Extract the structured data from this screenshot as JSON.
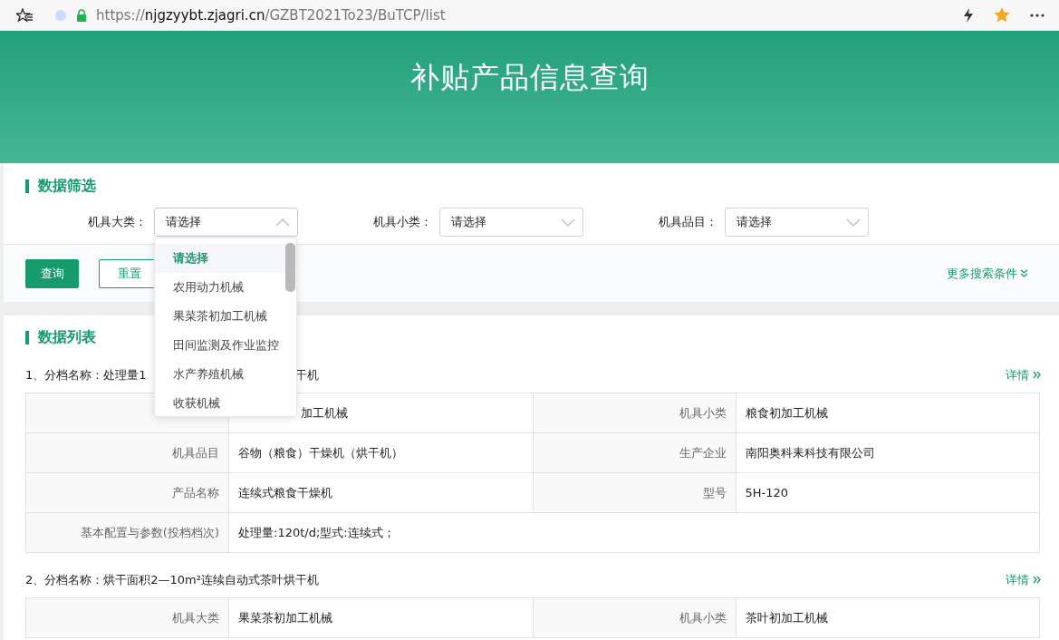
{
  "browser": {
    "url_scheme": "https://",
    "url_host": "njgzyybt.zjagri.cn",
    "url_path": "/GZBT2021To23/BuTCP/list"
  },
  "header": {
    "title": "补贴产品信息查询"
  },
  "filter": {
    "heading": "数据筛选",
    "selects": [
      {
        "label": "机具大类：",
        "value": "请选择",
        "open": true
      },
      {
        "label": "机具小类：",
        "value": "请选择",
        "open": false
      },
      {
        "label": "机具品目：",
        "value": "请选择",
        "open": false
      }
    ],
    "options": [
      {
        "label": "请选择",
        "selected": true
      },
      {
        "label": "农用动力机械",
        "selected": false
      },
      {
        "label": "果菜茶初加工机械",
        "selected": false
      },
      {
        "label": "田间监测及作业监控",
        "selected": false
      },
      {
        "label": "水产养殖机械",
        "selected": false
      },
      {
        "label": "收获机械",
        "selected": false
      }
    ],
    "buttons": [
      {
        "label": "查询",
        "kind": "primary"
      },
      {
        "label": "重置",
        "kind": "outline"
      }
    ],
    "more_link": "更多搜索条件"
  },
  "list": {
    "heading": "数据列表",
    "items": [
      {
        "title": "1、分档名称：处理量1",
        "title_tail": "干机",
        "detail_link": "详情",
        "rows": [
          [
            {
              "value": "加工机械",
              "covered": true
            },
            {
              "label": "机具小类",
              "value": "粮食初加工机械"
            }
          ],
          [
            {
              "label": "机具品目",
              "value": "谷物（粮食）干燥机（烘干机）"
            },
            {
              "label": "生产企业",
              "value": "南阳奥科耒科技有限公司"
            }
          ],
          [
            {
              "label": "产品名称",
              "value": "连续式粮食干燥机"
            },
            {
              "label": "型号",
              "value": "5H-120"
            }
          ],
          [
            {
              "label": "基本配置与参数(投档档次)",
              "value": "处理量:120t/d;型式:连续式；"
            }
          ]
        ]
      },
      {
        "title": "2、分档名称：烘干面积2—10m²连续自动式茶叶烘干机",
        "detail_link": "详情",
        "rows": [
          [
            {
              "label": "机具大类",
              "value": "果菜茶初加工机械"
            },
            {
              "label": "机具小类",
              "value": "茶叶初加工机械"
            }
          ]
        ]
      }
    ]
  }
}
